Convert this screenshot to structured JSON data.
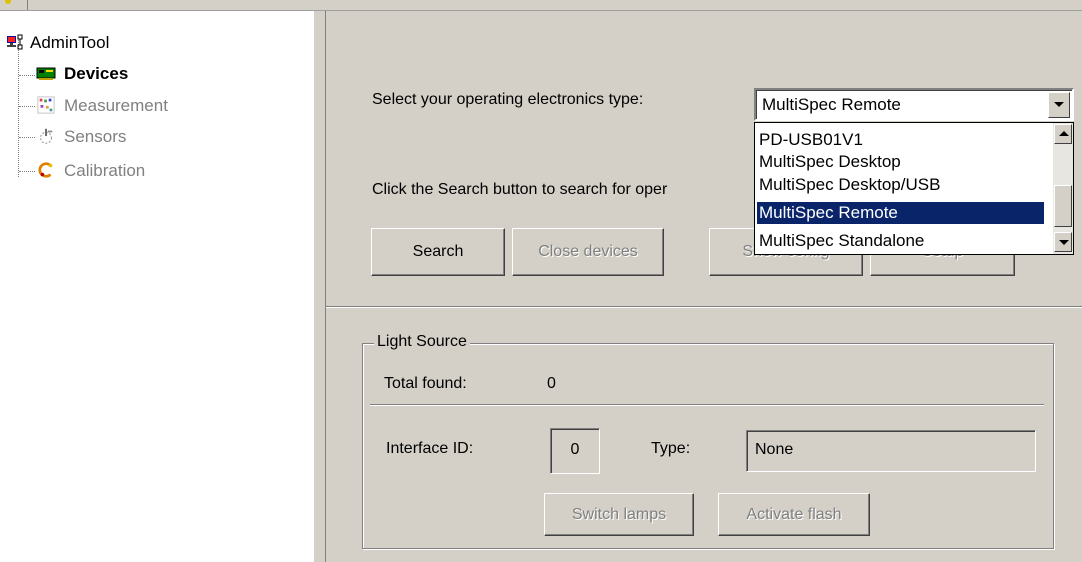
{
  "tree": {
    "root": "AdminTool",
    "items": [
      {
        "label": "Devices",
        "state": "selected"
      },
      {
        "label": "Measurement",
        "state": "disabled"
      },
      {
        "label": "Sensors",
        "state": "disabled"
      },
      {
        "label": "Calibration",
        "state": "disabled"
      }
    ]
  },
  "electronics": {
    "prompt": "Select your operating electronics type:",
    "selected": "MultiSpec Remote",
    "options": [
      "PD-USB01V1",
      "MultiSpec Desktop",
      "MultiSpec Desktop/USB",
      "MultiSpec Remote",
      "MultiSpec Standalone"
    ],
    "highlighted_index": 3
  },
  "search": {
    "prompt": "Click the Search button to search for oper",
    "buttons": {
      "search": "Search",
      "close_devices": "Close devices",
      "show_config": "Show config",
      "setup": "Setup"
    }
  },
  "light_source": {
    "title": "Light Source",
    "total_found_label": "Total found:",
    "total_found_value": "0",
    "interface_id_label": "Interface ID:",
    "interface_id_value": "0",
    "type_label": "Type:",
    "type_value": "None",
    "buttons": {
      "switch_lamps": "Switch lamps",
      "activate_flash": "Activate flash"
    }
  },
  "colors": {
    "face": "#d4d0c8",
    "selection": "#0a246a",
    "disabled_text": "#808080"
  }
}
